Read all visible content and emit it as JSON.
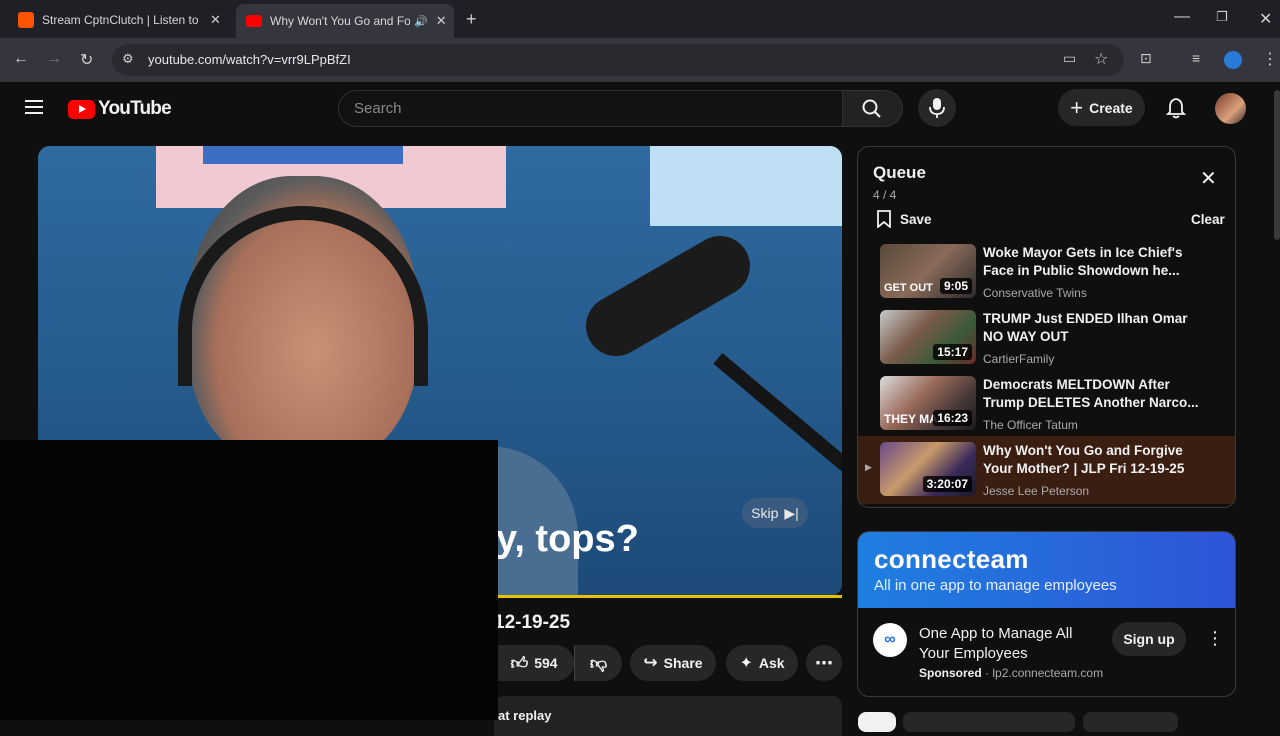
{
  "browser": {
    "tabs": [
      {
        "title": "Stream CptnClutch | Listen to m",
        "favicon_color": "#ff5500"
      },
      {
        "title": "Why Won't You Go and For",
        "favicon_color": "#ff0000"
      }
    ],
    "url": "youtube.com/watch?v=vrr9LPpBfZI"
  },
  "youtube": {
    "logo_text": "YouTube",
    "search_placeholder": "Search",
    "create_label": "Create"
  },
  "player": {
    "caption": "y, tops?",
    "skip_label": "Skip"
  },
  "video_info": {
    "title_fragment": "12-19-25",
    "like_count": "594",
    "share_label": "Share",
    "ask_label": "Ask",
    "chat_replay_fragment": "at replay"
  },
  "queue": {
    "title": "Queue",
    "position": "4 / 4",
    "save_label": "Save",
    "clear_label": "Clear",
    "items": [
      {
        "title": "Woke Mayor Gets in Ice Chief's Face in Public Showdown he...",
        "channel": "Conservative Twins",
        "duration": "9:05",
        "thumb_text": "GET OUT"
      },
      {
        "title": "TRUMP Just ENDED Ilhan Omar NO WAY OUT",
        "channel": "CartierFamily",
        "duration": "15:17",
        "thumb_text": ""
      },
      {
        "title": "Democrats MELTDOWN After Trump DELETES Another Narco...",
        "channel": "The Officer Tatum",
        "duration": "16:23",
        "thumb_text": "THEY MA"
      },
      {
        "title": "Why Won't You Go and Forgive Your Mother? | JLP Fri 12-19-25",
        "channel": "Jesse Lee Peterson",
        "duration": "3:20:07",
        "thumb_text": ""
      }
    ]
  },
  "ad": {
    "brand": "connecteam",
    "tagline": "All in one app to manage employees",
    "headline": "One App to Manage All Your Employees",
    "sponsored_label": "Sponsored",
    "domain": "lp2.connecteam.com",
    "cta_label": "Sign up"
  }
}
